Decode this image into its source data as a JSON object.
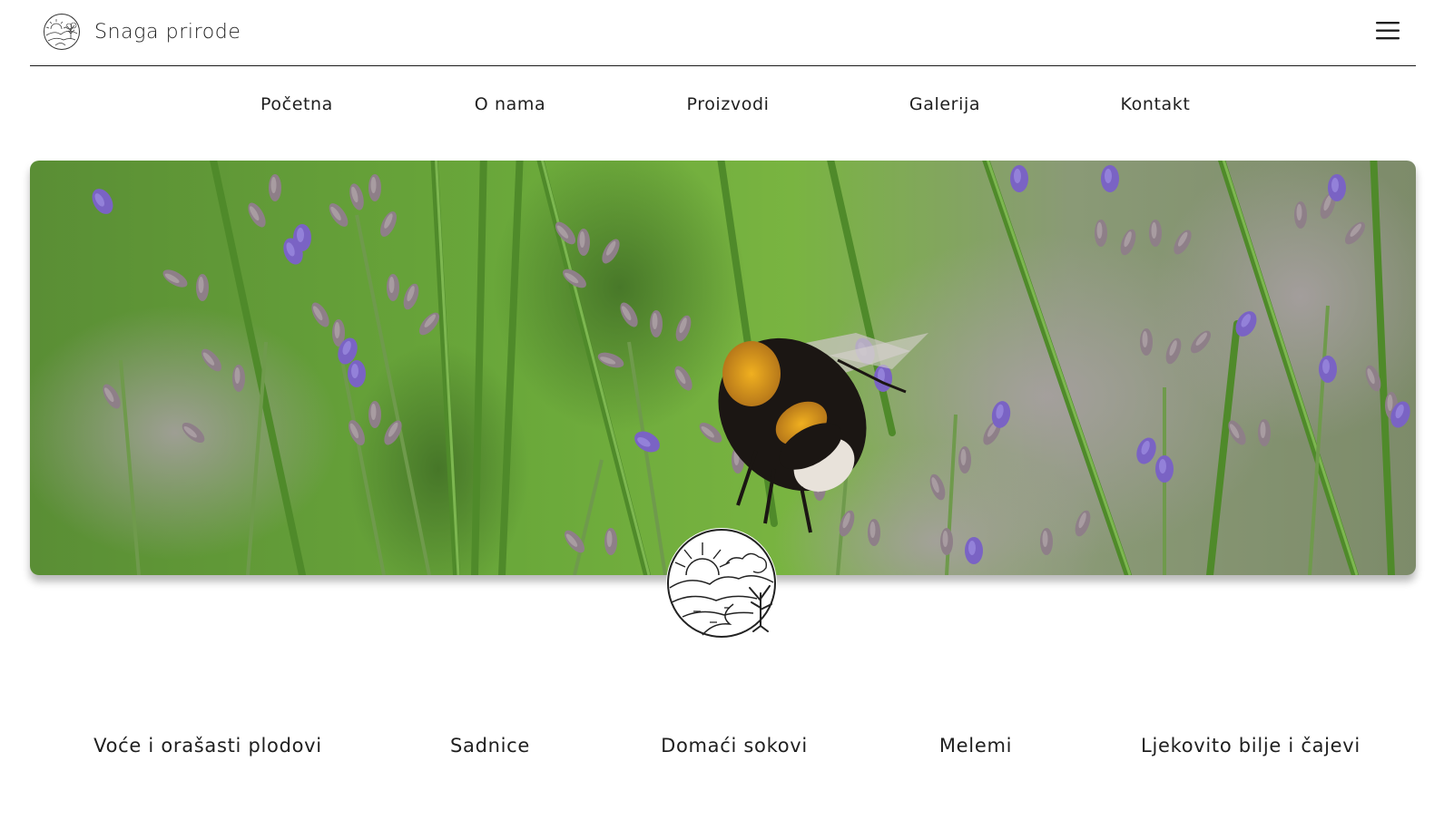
{
  "header": {
    "brand_name": "Snaga prirode",
    "logo_icon": "landscape-circle-logo-icon",
    "menu_icon": "hamburger-menu-icon"
  },
  "nav": {
    "items": [
      {
        "label": "Početna"
      },
      {
        "label": "O nama"
      },
      {
        "label": "Proizvodi"
      },
      {
        "label": "Galerija"
      },
      {
        "label": "Kontakt"
      }
    ]
  },
  "hero": {
    "image_subject": "bumblebee on lavender flowers",
    "emblem_icon": "landscape-emblem-icon"
  },
  "categories": {
    "items": [
      {
        "label": "Voće i orašasti plodovi"
      },
      {
        "label": "Sadnice"
      },
      {
        "label": "Domaći sokovi"
      },
      {
        "label": "Melemi"
      },
      {
        "label": "Ljekovito bilje i čajevi"
      }
    ]
  },
  "colors": {
    "text": "#1f1f1f",
    "rule": "#1a1a1a",
    "background": "#ffffff",
    "lavender": "#7a63c4",
    "grass": "#5e9e33"
  }
}
